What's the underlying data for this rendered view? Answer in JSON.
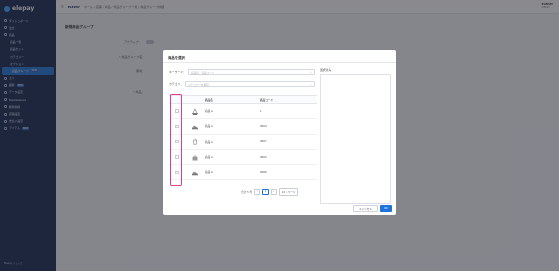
{
  "app": {
    "brand": "elepay",
    "brand_color": "#35a3ff"
  },
  "sidebar": {
    "items": [
      {
        "label": "ダッシュボード",
        "sub": false,
        "active": false
      },
      {
        "label": "注文",
        "sub": false,
        "active": false
      },
      {
        "label": "商品",
        "sub": false,
        "active": false
      },
      {
        "label": "商品一覧",
        "sub": true,
        "active": false
      },
      {
        "label": "商品セット",
        "sub": true,
        "active": false
      },
      {
        "label": "カテゴリー",
        "sub": true,
        "active": false
      },
      {
        "label": "オプション",
        "sub": true,
        "active": false
      },
      {
        "label": "商品グループ",
        "sub": true,
        "active": true,
        "badge": "NEW"
      },
      {
        "label": "エリ",
        "sub": false,
        "active": false
      },
      {
        "label": "顧客",
        "sub": false,
        "active": false,
        "badge": "NEW"
      },
      {
        "label": "データ設定",
        "sub": false,
        "active": false
      },
      {
        "label": "Marketplace",
        "sub": false,
        "active": false
      },
      {
        "label": "経営指標",
        "sub": false,
        "active": false
      },
      {
        "label": "店舗設定",
        "sub": false,
        "active": false
      },
      {
        "label": "支払い設定",
        "sub": false,
        "active": false
      },
      {
        "label": "アイテム",
        "sub": false,
        "active": false,
        "badge": "NEW"
      }
    ],
    "footer": "Elepay ショップ"
  },
  "topbar": {
    "account": "ELEPAY",
    "breadcrumb": "ホーム / 店舗 / 商品 / 商品グループ一覧 / 商品グループ詳細",
    "user_name": "ELEPAY",
    "user_sub": "ABCD"
  },
  "page": {
    "title": "新規商品グループ",
    "active_label": "アクティブ：",
    "group_name_label": "* 商品グループ名：",
    "remark_label": "備考：",
    "product_label": "* 商品：",
    "save": "保存"
  },
  "modal": {
    "title": "商品を選択",
    "keyword_label": "キーワード：",
    "keyword_placeholder": "商品名、商品コード",
    "category_label": "カテゴリ：",
    "category_placeholder": "カテゴリーを選択",
    "selected_label": "選択済み：",
    "columns": {
      "name": "商品名",
      "code": "商品コード"
    },
    "rows": [
      {
        "name": "商品 A",
        "code": "1",
        "icon": "dessert-icon"
      },
      {
        "name": "商品 A",
        "code": "0004",
        "icon": "shoe-icon"
      },
      {
        "name": "商品 A",
        "code": "0007",
        "icon": "drink-cup-icon"
      },
      {
        "name": "商品 A",
        "code": "0002",
        "icon": "cake-icon"
      },
      {
        "name": "商品 A",
        "code": "0006",
        "icon": "shoe-icon"
      }
    ],
    "pager": {
      "total": "合計 5 件",
      "current": "1",
      "page_size": "10 / ページ"
    },
    "cancel": "キャンセル",
    "ok": "OK"
  }
}
